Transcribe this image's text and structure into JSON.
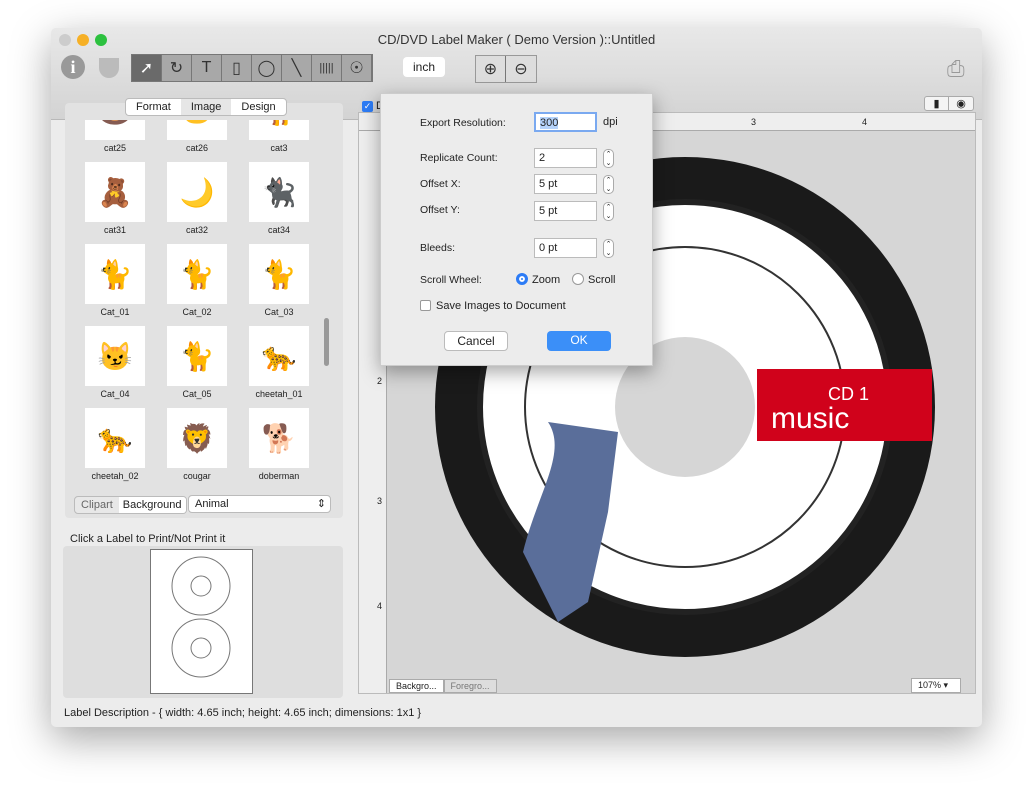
{
  "window": {
    "title": "CD/DVD Label Maker ( Demo Version )::Untitled"
  },
  "toolbar": {
    "unit": "inch",
    "tools": [
      "select-arrow",
      "rotate",
      "text",
      "rectangle",
      "ellipse",
      "line",
      "barcode",
      "image"
    ]
  },
  "left": {
    "tabs": [
      "Format",
      "Image",
      "Design"
    ],
    "active_tab": "Image",
    "clipart": [
      "cat25",
      "cat26",
      "cat3",
      "cat31",
      "cat32",
      "cat34",
      "Cat_01",
      "Cat_02",
      "Cat_03",
      "Cat_04",
      "Cat_05",
      "cheetah_01",
      "cheetah_02",
      "cougar",
      "doberman"
    ],
    "source_tabs": [
      "Clipart",
      "Background"
    ],
    "active_source": "Background",
    "category": "Animal",
    "print_hint": "Click a Label to Print/Not Print it"
  },
  "status": "Label Description - { width: 4.65 inch; height: 4.65 inch; dimensions: 1x1 }",
  "canvas": {
    "checkbox_label": "D",
    "ruler_marks": [
      "3",
      "4"
    ],
    "left_ruler": [
      "2",
      "3",
      "4"
    ],
    "layer_tabs": [
      "Backgro...",
      "Foregro..."
    ],
    "zoom": "107%",
    "label_line1": "CD 1",
    "label_line2": "music",
    "accent": "#d0021b"
  },
  "dialog": {
    "export_resolution_label": "Export Resolution:",
    "export_resolution": "300",
    "dpi": "dpi",
    "replicate_label": "Replicate Count:",
    "replicate": "2",
    "offset_x_label": "Offset X:",
    "offset_x": "5 pt",
    "offset_y_label": "Offset Y:",
    "offset_y": "5 pt",
    "bleeds_label": "Bleeds:",
    "bleeds": "0 pt",
    "scroll_label": "Scroll Wheel:",
    "zoom_option": "Zoom",
    "scroll_option": "Scroll",
    "scroll_selected": "Zoom",
    "save_images_label": "Save Images to Document",
    "save_images": false,
    "cancel": "Cancel",
    "ok": "OK"
  }
}
